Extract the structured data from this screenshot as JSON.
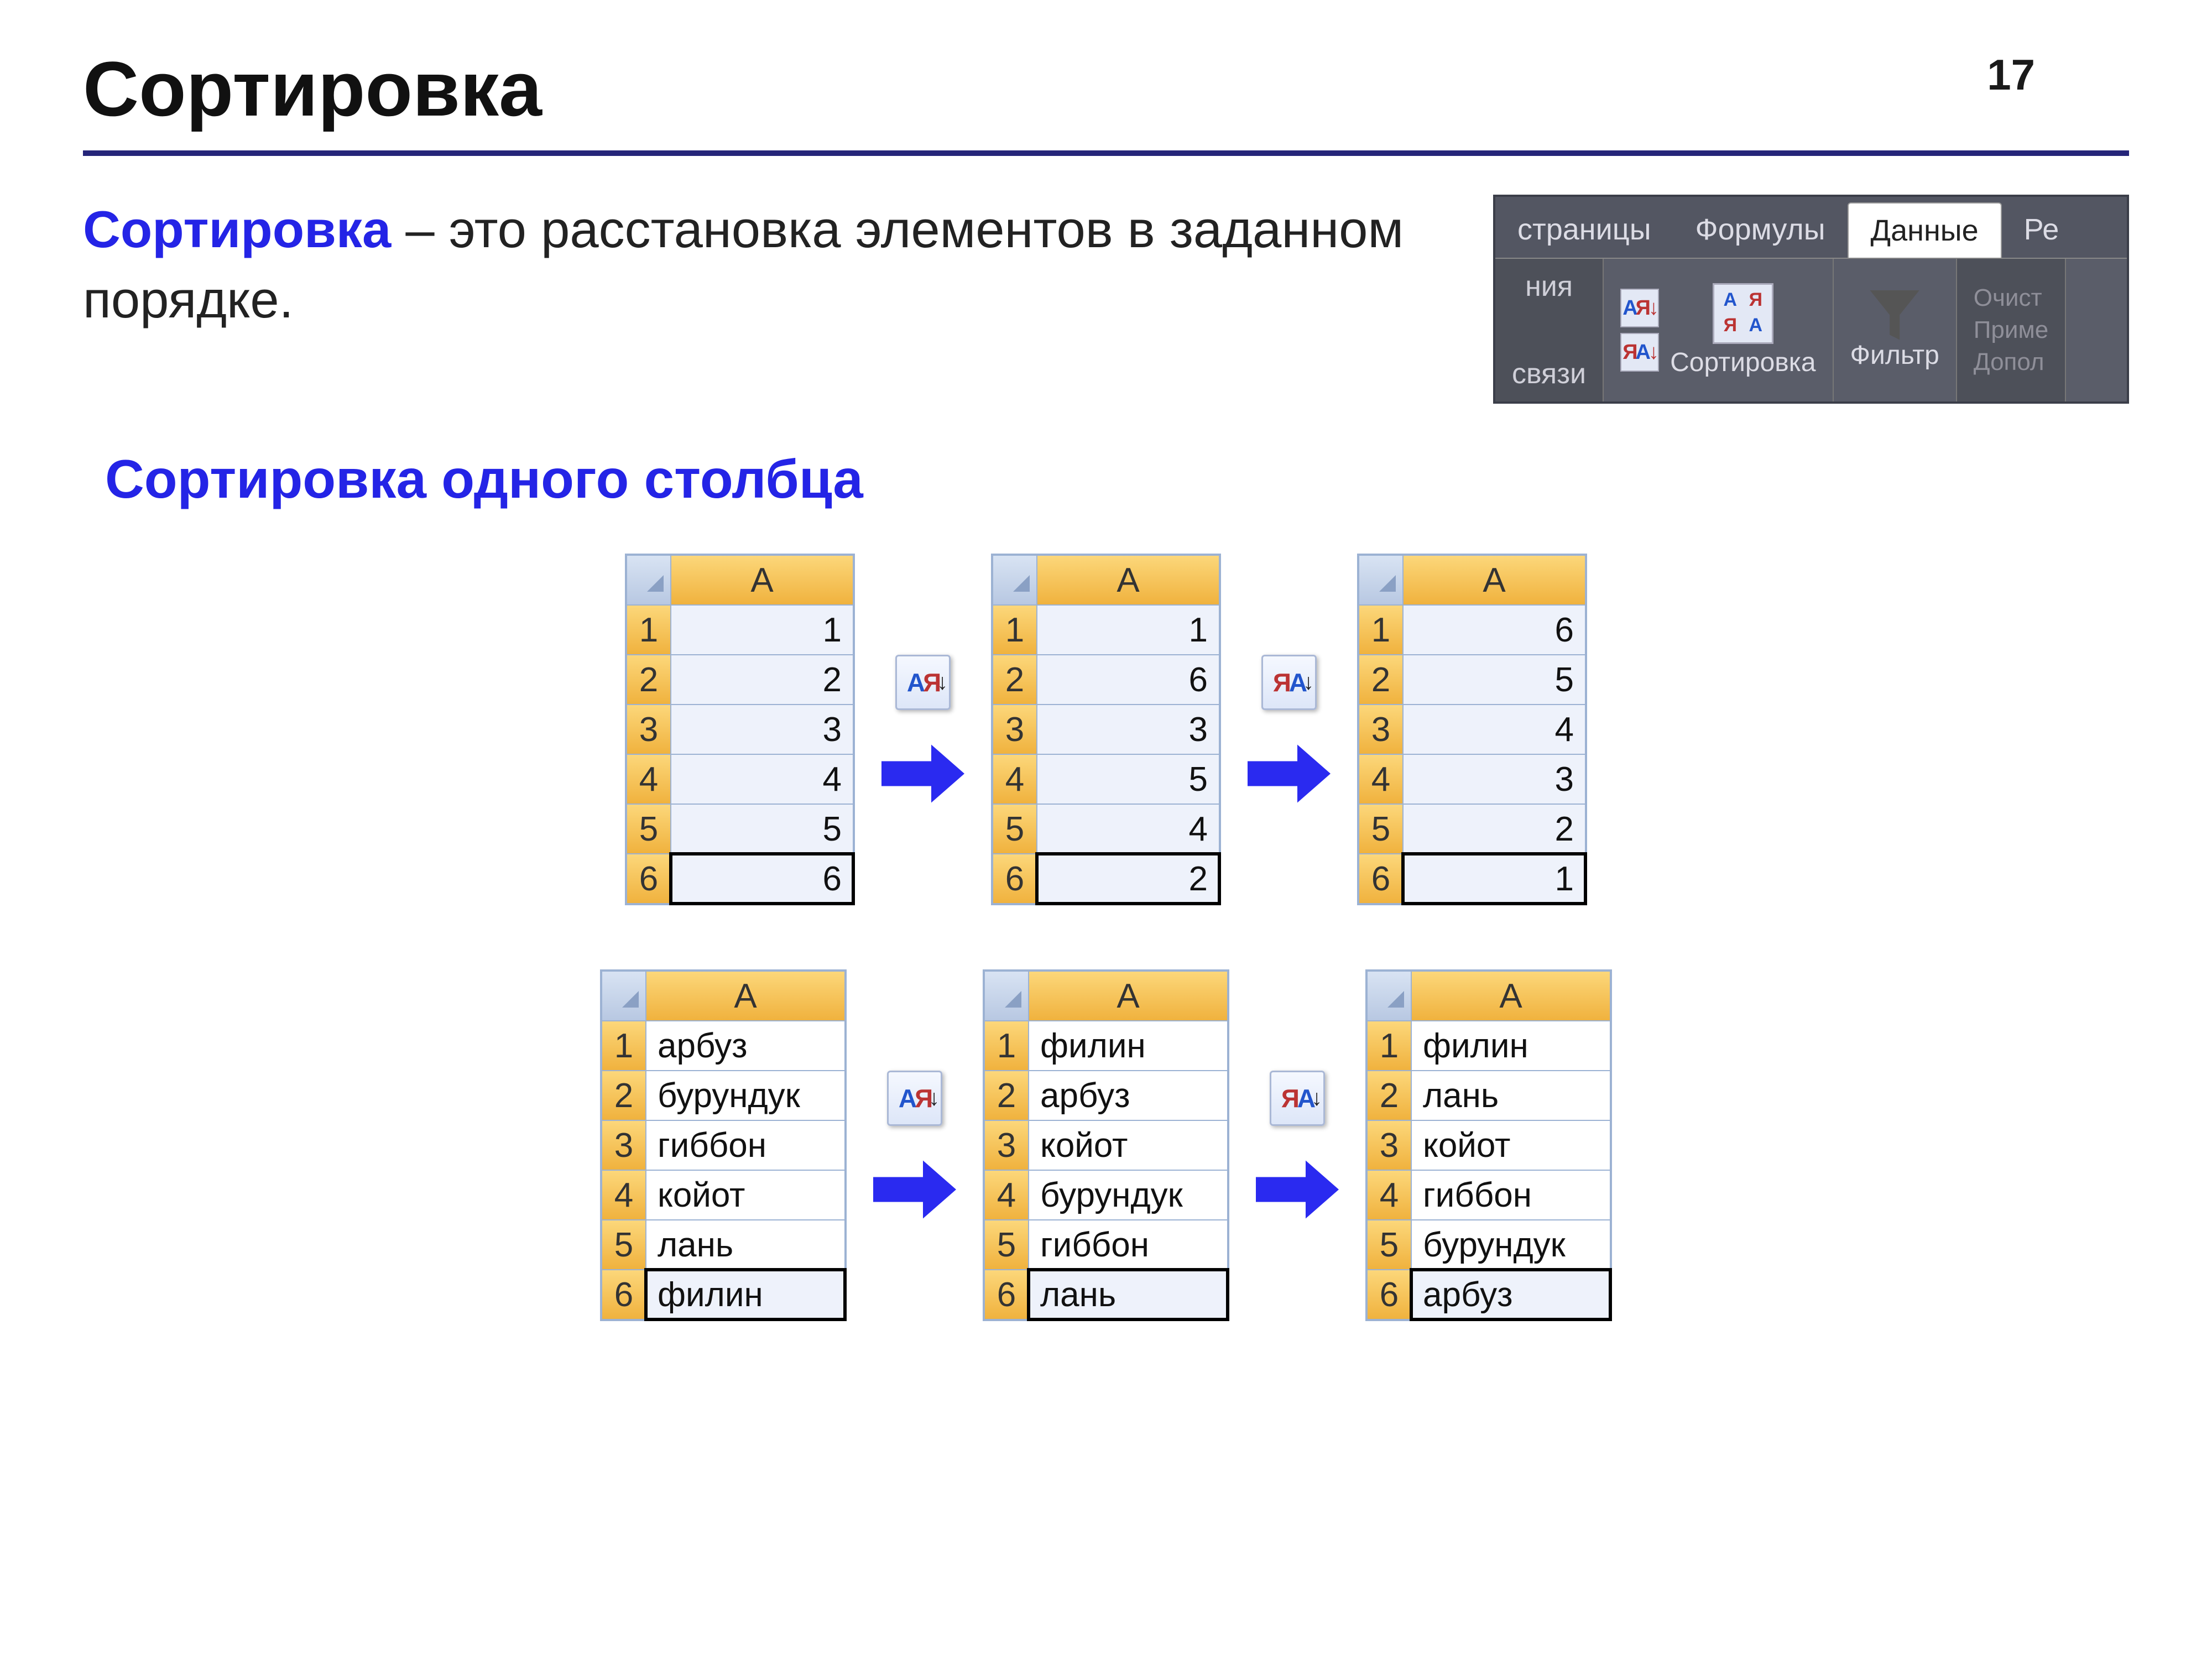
{
  "page_number": "17",
  "title": "Сортировка",
  "intro": {
    "term": "Сортировка",
    "rest": " – это расстановка элементов в заданном порядке."
  },
  "ribbon": {
    "tabs": {
      "t1": "страницы",
      "t2": "Формулы",
      "t3": "Данные",
      "t4": "Ре"
    },
    "left_frag": "ния",
    "conn_frag": "связи",
    "sort_label": "Сортировка",
    "filter_label": "Фильтр",
    "filter_opts": {
      "o1": "Очист",
      "o2": "Приме",
      "o3": "Допол"
    }
  },
  "subtitle": "Сортировка одного столбца",
  "row1": {
    "col_header": "A",
    "rows": [
      "1",
      "2",
      "3",
      "4",
      "5",
      "6"
    ],
    "t_left": [
      "1",
      "2",
      "3",
      "4",
      "5",
      "6"
    ],
    "t_mid": [
      "1",
      "6",
      "3",
      "5",
      "4",
      "2"
    ],
    "t_right": [
      "6",
      "5",
      "4",
      "3",
      "2",
      "1"
    ],
    "sort_asc_icon": {
      "top": "А",
      "bot": "Я"
    },
    "sort_desc_icon": {
      "top": "Я",
      "bot": "А"
    }
  },
  "row2": {
    "col_header": "A",
    "rows": [
      "1",
      "2",
      "3",
      "4",
      "5",
      "6"
    ],
    "t_left": [
      "арбуз",
      "бурундук",
      "гиббон",
      "койот",
      "лань",
      "филин"
    ],
    "t_mid": [
      "филин",
      "арбуз",
      "койот",
      "бурундук",
      "гиббон",
      "лань"
    ],
    "t_right": [
      "филин",
      "лань",
      "койот",
      "гиббон",
      "бурундук",
      "арбуз"
    ],
    "sort_asc_icon": {
      "top": "А",
      "bot": "Я"
    },
    "sort_desc_icon": {
      "top": "Я",
      "bot": "А"
    }
  }
}
